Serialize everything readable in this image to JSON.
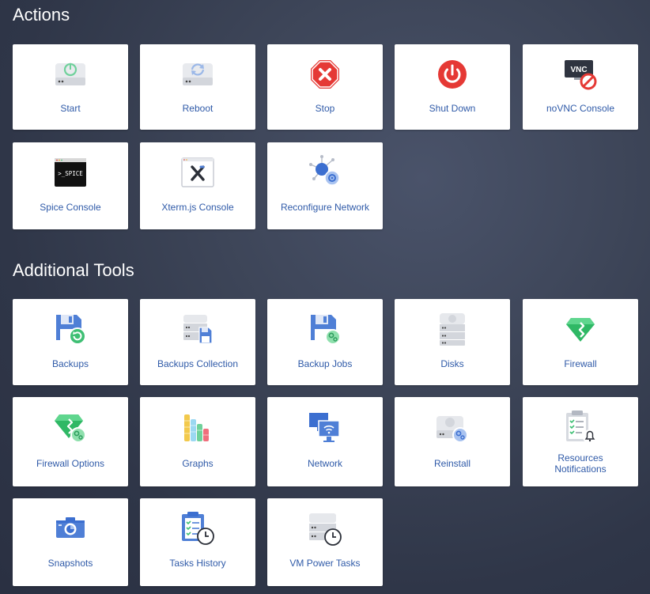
{
  "sections": {
    "actions_title": "Actions",
    "tools_title": "Additional Tools"
  },
  "actions": [
    {
      "label": "Start",
      "icon": "power-drive-icon"
    },
    {
      "label": "Reboot",
      "icon": "reboot-drive-icon"
    },
    {
      "label": "Stop",
      "icon": "stop-octagon-icon"
    },
    {
      "label": "Shut Down",
      "icon": "power-red-icon"
    },
    {
      "label": "noVNC Console",
      "icon": "vnc-disabled-icon"
    },
    {
      "label": "Spice Console",
      "icon": "spice-terminal-icon"
    },
    {
      "label": "Xterm.js Console",
      "icon": "xterm-window-icon"
    },
    {
      "label": "Reconfigure Network",
      "icon": "network-gear-icon"
    }
  ],
  "tools": [
    {
      "label": "Backups",
      "icon": "floppy-restore-icon"
    },
    {
      "label": "Backups Collection",
      "icon": "server-floppy-icon"
    },
    {
      "label": "Backup Jobs",
      "icon": "floppy-gear-icon"
    },
    {
      "label": "Disks",
      "icon": "disk-stack-icon"
    },
    {
      "label": "Firewall",
      "icon": "gem-shield-icon"
    },
    {
      "label": "Firewall Options",
      "icon": "gem-gear-icon"
    },
    {
      "label": "Graphs",
      "icon": "bar-cylinders-icon"
    },
    {
      "label": "Network",
      "icon": "monitors-wifi-icon"
    },
    {
      "label": "Reinstall",
      "icon": "drive-gear-icon"
    },
    {
      "label": "Resources Notifications",
      "label_line1": "Resources",
      "label_line2": "Notifications",
      "icon": "clipboard-bell-icon"
    },
    {
      "label": "Snapshots",
      "icon": "camera-icon"
    },
    {
      "label": "Tasks History",
      "icon": "clipboard-clock-icon"
    },
    {
      "label": "VM Power Tasks",
      "icon": "server-clock-icon"
    }
  ],
  "colors": {
    "label": "#2f5aa8",
    "green": "#4cc27a",
    "red": "#e53935",
    "blue": "#4f7fd6"
  }
}
